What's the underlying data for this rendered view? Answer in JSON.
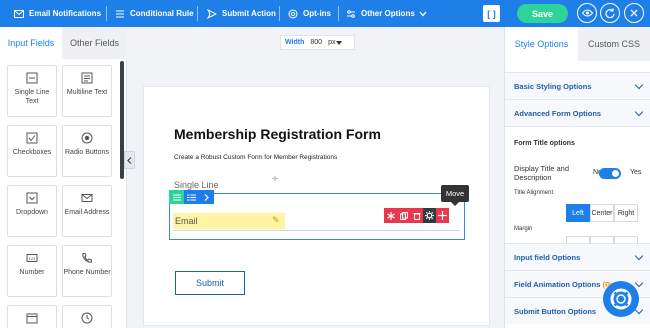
{
  "toolbar": {
    "email_notifications": "Email Notifications",
    "conditional_rule": "Conditional Rule",
    "submit_action": "Submit Action",
    "opt_ins": "Opt-ins",
    "other_options": "Other Options",
    "bracket": "[ ]",
    "save": "Save",
    "colors": {
      "bar": "#1e7fe8",
      "save": "#2ed39a"
    }
  },
  "left_panel": {
    "tabs": [
      "Input Fields",
      "Other Fields"
    ],
    "fields": [
      {
        "label": "Single Line Text",
        "icon": "single-line-icon"
      },
      {
        "label": "Multiline Text",
        "icon": "multiline-icon"
      },
      {
        "label": "Checkboxes",
        "icon": "checkbox-icon"
      },
      {
        "label": "Radio Buttons",
        "icon": "radio-icon"
      },
      {
        "label": "Dropdown",
        "icon": "dropdown-icon"
      },
      {
        "label": "Email Address",
        "icon": "envelope-icon"
      },
      {
        "label": "Number",
        "icon": "number-icon"
      },
      {
        "label": "Phone Number",
        "icon": "phone-icon"
      },
      {
        "label": "",
        "icon": "calendar-icon"
      },
      {
        "label": "",
        "icon": "clock-icon"
      }
    ]
  },
  "canvas": {
    "width_label": "Width",
    "width_value": "800",
    "width_unit": "px",
    "form_title": "Membership Registration Form",
    "form_subtitle": "Create a Robust Custom Form for Member Registrations",
    "single_line_label": "Single Line",
    "email_field": "Email",
    "move_tooltip": "Move",
    "submit_label": "Submit"
  },
  "right_panel": {
    "tabs": [
      "Style Options",
      "Custom CSS"
    ],
    "basic_styling": "Basic Styling Options",
    "advanced_form": "Advanced Form Options",
    "form_title_options": "Form Title options",
    "display_title": "Display Title and Description",
    "toggle_no": "No",
    "toggle_yes": "Yes",
    "title_alignment": "Title Alignment",
    "align_left": "Left",
    "align_center": "Center",
    "align_right": "Right",
    "margin": "Margin",
    "input_field_options": "Input field Options",
    "field_animation": "Field Animation Options",
    "field_animation_pro": "(Pro)",
    "submit_button_options": "Submit Button Options"
  }
}
